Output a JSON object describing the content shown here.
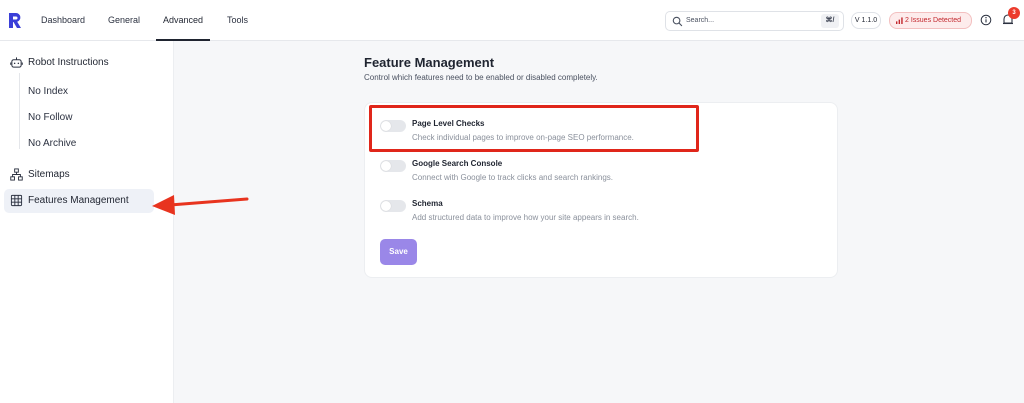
{
  "topbar": {
    "tabs": [
      {
        "label": "Dashboard"
      },
      {
        "label": "General"
      },
      {
        "label": "Advanced"
      },
      {
        "label": "Tools"
      }
    ],
    "active_tab": "Advanced",
    "search": {
      "placeholder": "Search...",
      "shortcut": "⌘/"
    },
    "version": "V 1.1.0",
    "issues": "2 Issues Detected",
    "notification_count": "3"
  },
  "sidebar": {
    "items": [
      {
        "label": "Robot Instructions",
        "icon": "robot-icon"
      },
      {
        "label": "No Index"
      },
      {
        "label": "No Follow"
      },
      {
        "label": "No Archive"
      },
      {
        "label": "Sitemaps",
        "icon": "sitemap-icon"
      },
      {
        "label": "Features Management",
        "icon": "grid-icon"
      }
    ]
  },
  "main": {
    "title": "Feature Management",
    "subtitle": "Control which features need to be enabled or disabled completely.",
    "features": [
      {
        "title": "Page Level Checks",
        "desc": "Check individual pages to improve on-page SEO performance.",
        "enabled": false
      },
      {
        "title": "Google Search Console",
        "desc": "Connect with Google to track clicks and search rankings.",
        "enabled": false
      },
      {
        "title": "Schema",
        "desc": "Add structured data to improve how your site appears in search.",
        "enabled": false
      }
    ],
    "save_label": "Save"
  },
  "colors": {
    "accent": "#9a87e8",
    "brand": "#3b3fd8",
    "alert": "#c2272d",
    "annotation": "#e0261a"
  }
}
